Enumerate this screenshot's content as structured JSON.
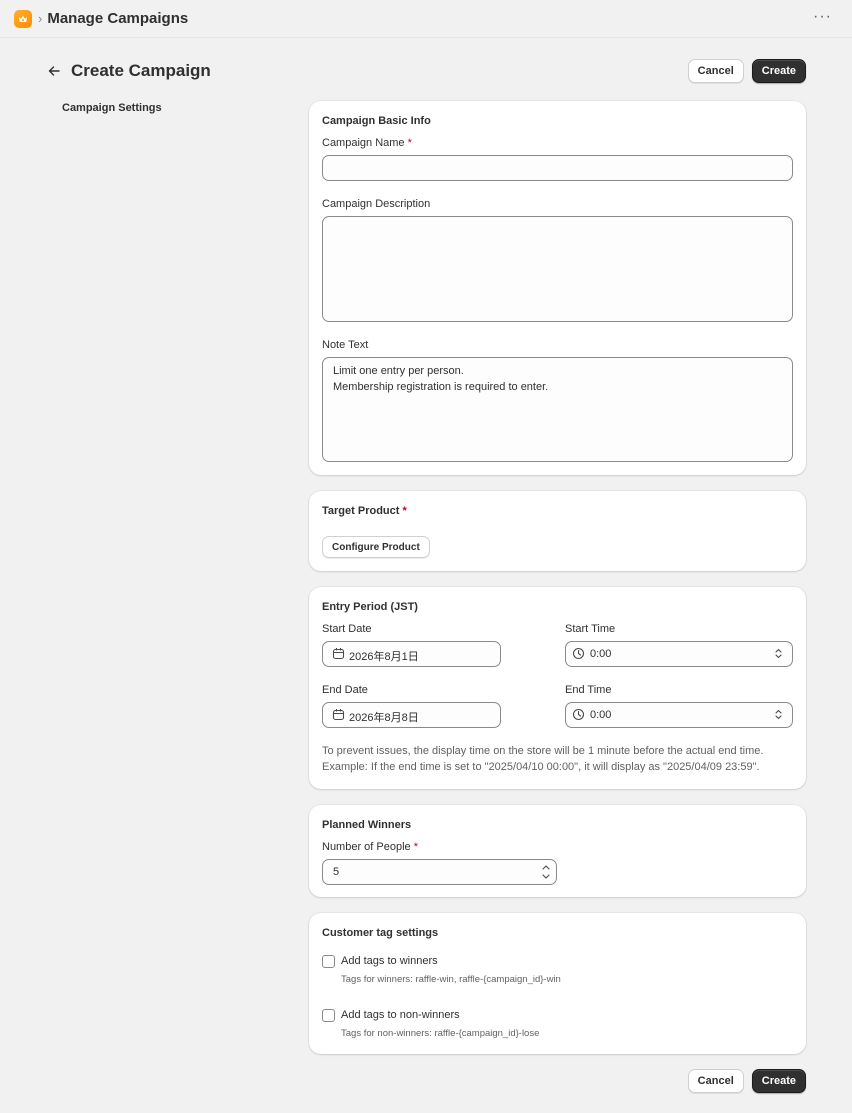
{
  "app": {
    "title": "Manage Campaigns",
    "more_menu": "···"
  },
  "page": {
    "title": "Create Campaign",
    "cancel_label": "Cancel",
    "create_label": "Create"
  },
  "sidebar": {
    "section_label": "Campaign Settings"
  },
  "basic_info": {
    "title": "Campaign Basic Info",
    "name_label": "Campaign Name",
    "required_mark": "*",
    "name_value": "",
    "description_label": "Campaign Description",
    "description_value": "",
    "note_label": "Note Text",
    "note_value": "Limit one entry per person.\nMembership registration is required to enter."
  },
  "target_product": {
    "title": "Target Product",
    "required_mark": "*",
    "configure_label": "Configure Product"
  },
  "entry_period": {
    "title": "Entry Period (JST)",
    "start_date_label": "Start Date",
    "start_date_value": "2026年8月1日",
    "start_time_label": "Start Time",
    "start_time_value": "0:00",
    "end_date_label": "End Date",
    "end_date_value": "2026年8月8日",
    "end_time_label": "End Time",
    "end_time_value": "0:00",
    "note_line1": "To prevent issues, the display time on the store will be 1 minute before the actual end time.",
    "note_line2": "Example: If the end time is set to \"2025/04/10 00:00\", it will display as \"2025/04/09 23:59\"."
  },
  "planned_winners": {
    "title": "Planned Winners",
    "people_label": "Number of People",
    "required_mark": "*",
    "people_value": "5"
  },
  "customer_tags": {
    "title": "Customer tag settings",
    "winners_label": "Add tags to winners",
    "winners_sub": "Tags for winners: raffle-win, raffle-{campaign_id}-win",
    "non_winners_label": "Add tags to non-winners",
    "non_winners_sub": "Tags for non-winners: raffle-{campaign_id}-lose"
  },
  "colors": {
    "primary_button": "#303030",
    "required": "#c4001f",
    "app_icon": "#ff9f1a"
  }
}
